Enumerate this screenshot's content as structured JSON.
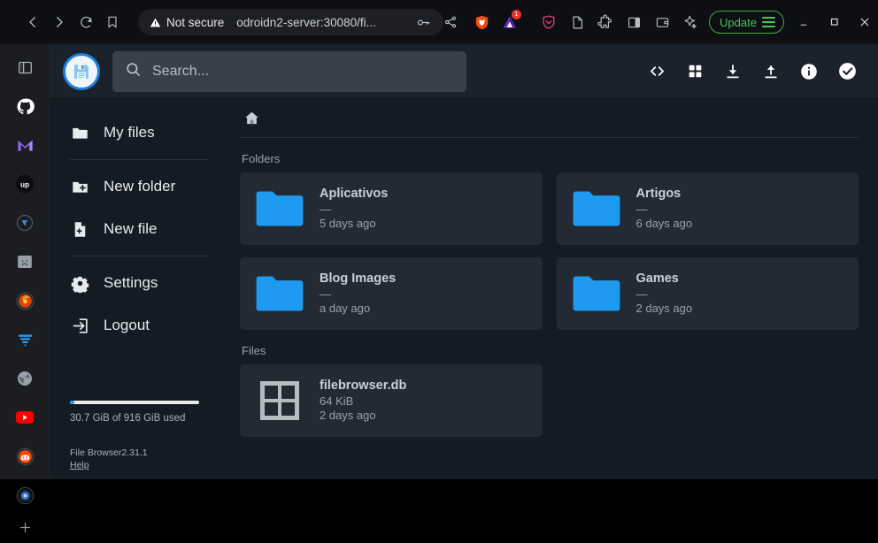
{
  "browser": {
    "nav": {
      "back": "back-button",
      "forward": "forward-button",
      "reload": "reload-button",
      "bookmark": "bookmark-button"
    },
    "address": {
      "security_label": "Not secure",
      "url": "odroidn2-server:30080/fi...",
      "key_icon": "password-key-icon",
      "share_icon": "share-icon"
    },
    "extensions": [
      {
        "name": "brave-shields-icon",
        "badge": ""
      },
      {
        "name": "extension-triangle-icon",
        "badge": "1"
      },
      {
        "name": "brave-rewards-shield-icon",
        "badge": ""
      },
      {
        "name": "reading-list-icon",
        "badge": ""
      },
      {
        "name": "puzzle-extensions-icon",
        "badge": ""
      },
      {
        "name": "sidebar-toggle-icon",
        "badge": ""
      },
      {
        "name": "wallet-icon",
        "badge": ""
      },
      {
        "name": "leo-ai-icon",
        "badge": ""
      }
    ],
    "update_button": "Update",
    "window_controls": {
      "minimize": "minimize-button",
      "maximize": "maximize-button",
      "close": "close-button"
    },
    "sidebar_items": [
      "panel-toggle-icon",
      "github-icon",
      "gmail-icon",
      "upwork-icon",
      "globe-blue-icon",
      "image-placeholder-icon",
      "firefox-icon",
      "filter-funnel-icon",
      "globe-gray-icon",
      "youtube-icon",
      "reddit-icon",
      "blue-circle-icon",
      "add-icon"
    ]
  },
  "app": {
    "logo_icon": "floppy-disk-save-icon",
    "search": {
      "placeholder": "Search...",
      "value": "",
      "icon": "search-icon"
    },
    "header_actions": [
      "code-brackets-icon",
      "grid-view-icon",
      "download-icon",
      "upload-icon",
      "info-icon",
      "check-circle-icon"
    ],
    "nav": {
      "my_files": "My files",
      "new_folder": "New folder",
      "new_file": "New file",
      "settings": "Settings",
      "logout": "Logout"
    },
    "usage": {
      "percent": 3.35,
      "text": "30.7 GiB of 916 GiB used"
    },
    "footer": {
      "version": "File Browser2.31.1",
      "help": "Help"
    },
    "breadcrumb": {
      "home_icon": "home-icon"
    },
    "sections": {
      "folders_title": "Folders",
      "files_title": "Files"
    },
    "folders": [
      {
        "name": "Aplicativos",
        "size": "—",
        "time": "5 days ago",
        "icon": "folder-icon"
      },
      {
        "name": "Artigos",
        "size": "—",
        "time": "6 days ago",
        "icon": "folder-icon"
      },
      {
        "name": "Blog Images",
        "size": "—",
        "time": "a day ago",
        "icon": "folder-icon"
      },
      {
        "name": "Games",
        "size": "—",
        "time": "2 days ago",
        "icon": "folder-icon"
      }
    ],
    "files": [
      {
        "name": "filebrowser.db",
        "size": "64 KiB",
        "time": "2 days ago",
        "icon": "database-grid-icon"
      }
    ]
  },
  "colors": {
    "accent_blue": "#2196f3",
    "folder_blue": "#1e9bf0",
    "update_green": "#4bc455",
    "badge_red": "#e8342b",
    "app_bg": "#141b24",
    "card_bg": "#232a33",
    "header_bg": "#1b222b"
  }
}
